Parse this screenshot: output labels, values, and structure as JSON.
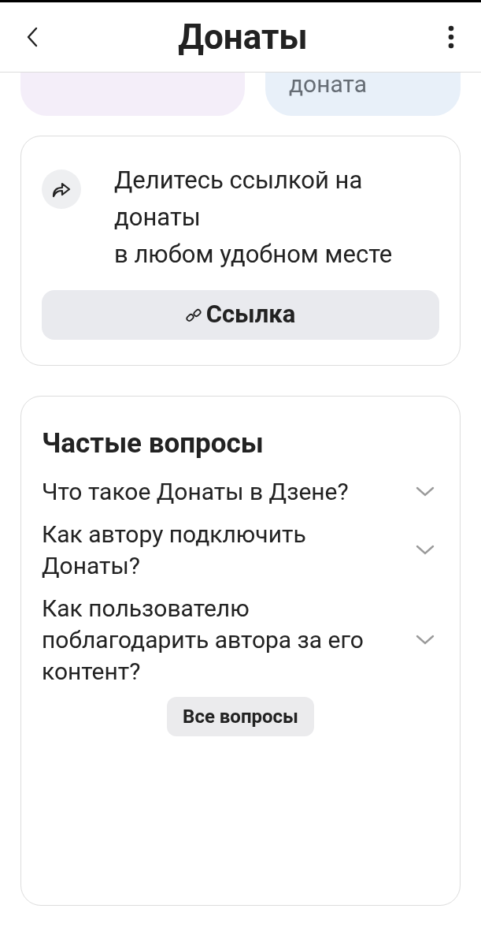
{
  "header": {
    "title": "Донаты"
  },
  "top_cards": [
    {
      "kind": "pink"
    },
    {
      "kind": "blue",
      "text": "доната"
    }
  ],
  "share_card": {
    "text": "Делитесь ссылкой на донаты\nв любом удобном месте",
    "button": "Ссылка"
  },
  "faq": {
    "title": "Частые вопросы",
    "questions": [
      {
        "text": "Что такое Донаты в Дзене?",
        "expanded": false
      },
      {
        "text": "Как автору подключить Донаты?",
        "expanded": false
      },
      {
        "text": "Как пользователю поблагодарить автора за его контент?",
        "expanded": false
      }
    ],
    "button": "Все вопросы"
  }
}
